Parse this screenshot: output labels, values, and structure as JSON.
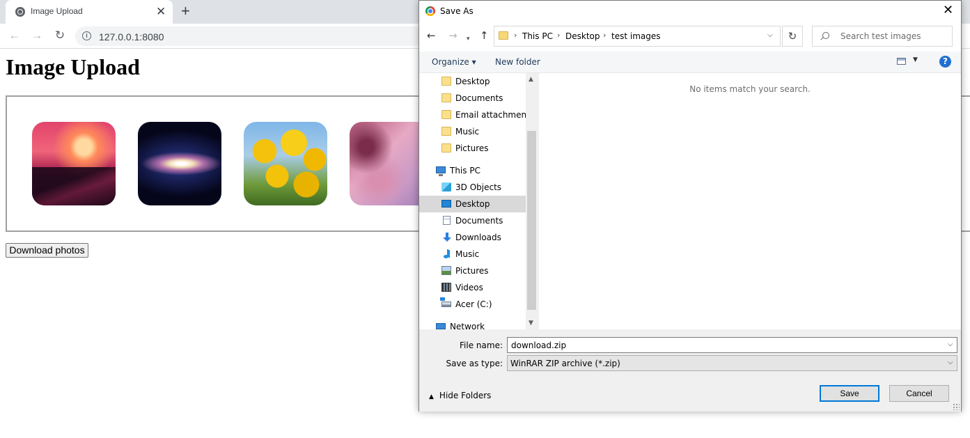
{
  "browser": {
    "tab_title": "Image Upload",
    "url": "127.0.0.1:8080"
  },
  "page": {
    "title": "Image Upload",
    "download_button": "Download photos"
  },
  "dialog": {
    "title": "Save As",
    "breadcrumb": [
      "This PC",
      "Desktop",
      "test images"
    ],
    "search_placeholder": "Search test images",
    "toolbar": {
      "organize": "Organize",
      "new_folder": "New folder",
      "help": "?"
    },
    "nav_items": [
      {
        "label": "Desktop",
        "icon": "folder-icon"
      },
      {
        "label": "Documents",
        "icon": "folder-icon"
      },
      {
        "label": "Email attachments",
        "icon": "folder-icon"
      },
      {
        "label": "Music",
        "icon": "folder-icon"
      },
      {
        "label": "Pictures",
        "icon": "folder-icon"
      },
      {
        "label": "This PC",
        "icon": "computer-icon"
      },
      {
        "label": "3D Objects",
        "icon": "cube-icon"
      },
      {
        "label": "Desktop",
        "icon": "desktop-icon",
        "selected": true
      },
      {
        "label": "Documents",
        "icon": "document-icon"
      },
      {
        "label": "Downloads",
        "icon": "download-arrow-icon"
      },
      {
        "label": "Music",
        "icon": "music-note-icon"
      },
      {
        "label": "Pictures",
        "icon": "picture-icon"
      },
      {
        "label": "Videos",
        "icon": "film-icon"
      },
      {
        "label": "Acer (C:)",
        "icon": "drive-icon"
      },
      {
        "label": "Network",
        "icon": "network-icon"
      }
    ],
    "empty_message": "No items match your search.",
    "file_name_label": "File name:",
    "file_name_value": "download.zip",
    "save_type_label": "Save as type:",
    "save_type_value": "WinRAR ZIP archive (*.zip)",
    "hide_folders": "Hide Folders",
    "save_button": "Save",
    "cancel_button": "Cancel"
  },
  "colors": {
    "accent": "#0078d7",
    "selection": "#d9d9d9"
  }
}
